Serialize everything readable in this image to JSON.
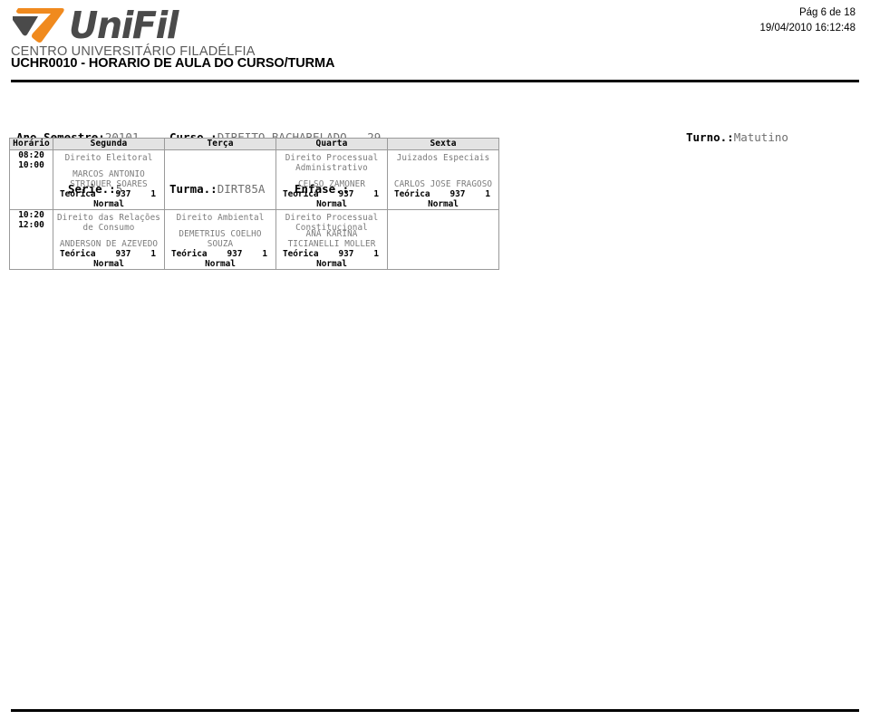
{
  "institution": {
    "logo_word": "UniFil",
    "logo_subtitle": "CENTRO UNIVERSITÁRIO FILADÉLFIA",
    "logo_colors": {
      "orange": "#F08A1E",
      "gray": "#4a4a4a"
    }
  },
  "page_info": {
    "page_label": "Pág 6 de 18",
    "datetime": "19/04/2010  16:12:48"
  },
  "report": {
    "title": "UCHR0010 - HORARIO DE AULA DO CURSO/TURMA"
  },
  "meta": {
    "ano_semestre_label": "Ano Semestre:",
    "ano_semestre_value": "20101",
    "curso_label": "Curso.:",
    "curso_value": "DIREITO-BACHARELADO - 29",
    "turno_label": "Turno.:",
    "turno_value": "Matutino",
    "serie_label": "Serie.:",
    "serie_value": "5",
    "turma_label": "Turma.:",
    "turma_value": "DIRT85A",
    "enfase_label": "Enfase.:",
    "enfase_value": ""
  },
  "schedule": {
    "columns": [
      "Horário",
      "Segunda",
      "Terça",
      "Quarta",
      "Sexta"
    ],
    "rows": [
      {
        "time_start": "08:20",
        "time_end": "10:00",
        "cells": [
          {
            "day": "Segunda",
            "empty": false,
            "discipline": "Direito Eleitoral",
            "professor": "MARCOS ANTONIO STRIQUER SOARES",
            "tipo": "Teórica",
            "codigo": "937",
            "numero": "1",
            "situacao": "Normal"
          },
          {
            "day": "Terça",
            "empty": true,
            "discipline": "",
            "professor": "",
            "tipo": "",
            "codigo": "",
            "numero": "",
            "situacao": ""
          },
          {
            "day": "Quarta",
            "empty": false,
            "discipline": "Direito Processual Administrativo",
            "professor": "CELSO ZAMONER",
            "tipo": "Teórica",
            "codigo": "937",
            "numero": "1",
            "situacao": "Normal"
          },
          {
            "day": "Sexta",
            "empty": false,
            "discipline": "Juizados Especiais",
            "professor": "CARLOS JOSE FRAGOSO",
            "tipo": "Teórica",
            "codigo": "937",
            "numero": "1",
            "situacao": "Normal"
          }
        ]
      },
      {
        "time_start": "10:20",
        "time_end": "12:00",
        "cells": [
          {
            "day": "Segunda",
            "empty": false,
            "discipline": "Direito das Relações de Consumo",
            "professor": "ANDERSON DE AZEVEDO",
            "tipo": "Teórica",
            "codigo": "937",
            "numero": "1",
            "situacao": "Normal"
          },
          {
            "day": "Terça",
            "empty": false,
            "discipline": "Direito Ambiental",
            "professor": "DEMETRIUS COELHO SOUZA",
            "tipo": "Teórica",
            "codigo": "937",
            "numero": "1",
            "situacao": "Normal"
          },
          {
            "day": "Quarta",
            "empty": false,
            "discipline": "Direito Processual Constitucional",
            "professor": "ANA KARINA TICIANELLI MOLLER",
            "tipo": "Teórica",
            "codigo": "937",
            "numero": "1",
            "situacao": "Normal"
          },
          {
            "day": "Sexta",
            "empty": true,
            "discipline": "",
            "professor": "",
            "tipo": "",
            "codigo": "",
            "numero": "",
            "situacao": ""
          }
        ]
      }
    ]
  }
}
